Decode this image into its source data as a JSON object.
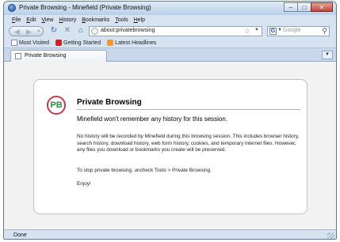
{
  "window": {
    "title": "Private Browsing - Minefield (Private Browsing)",
    "controls": {
      "minimize": "–",
      "maximize": "□",
      "close": "✕"
    }
  },
  "menu": [
    {
      "hot": "F",
      "rest": "ile"
    },
    {
      "hot": "E",
      "rest": "dit"
    },
    {
      "hot": "V",
      "rest": "iew"
    },
    {
      "hot": "H",
      "rest": "istory"
    },
    {
      "hot": "B",
      "rest": "ookmarks"
    },
    {
      "hot": "T",
      "rest": "ools"
    },
    {
      "hot": "H",
      "rest": "elp"
    }
  ],
  "navbar": {
    "back_icon": "back-arrow-icon",
    "forward_icon": "forward-arrow-icon",
    "url": "about:privatebrowsing",
    "search_engine": "G",
    "search_placeholder": "Google"
  },
  "bookmarks": [
    {
      "label": "Most Visited",
      "icon": "page"
    },
    {
      "label": "Getting Started",
      "icon": "moz"
    },
    {
      "label": "Latest Headlines",
      "icon": "rss"
    }
  ],
  "tab": {
    "label": "Private Browsing"
  },
  "page": {
    "logo": "PB",
    "title": "Private Browsing",
    "subtitle": "Minefield won't remember any history for this session.",
    "description": "No history will be recorded by Minefield during this browsing session. This includes browser history, search history, download history, web form history, cookies, and temporary internet files. However, any files you download or bookmarks you create will be preserved.",
    "stop_text": "To stop private browsing, uncheck Tools > Private Browsing.",
    "enjoy": "Enjoy!"
  },
  "status": {
    "text": "Done"
  },
  "colors": {
    "logo_ring": "#c53a4b",
    "logo_text": "#2b8a3e",
    "chrome": "#d7e3f0",
    "close_button": "#c0473a"
  }
}
